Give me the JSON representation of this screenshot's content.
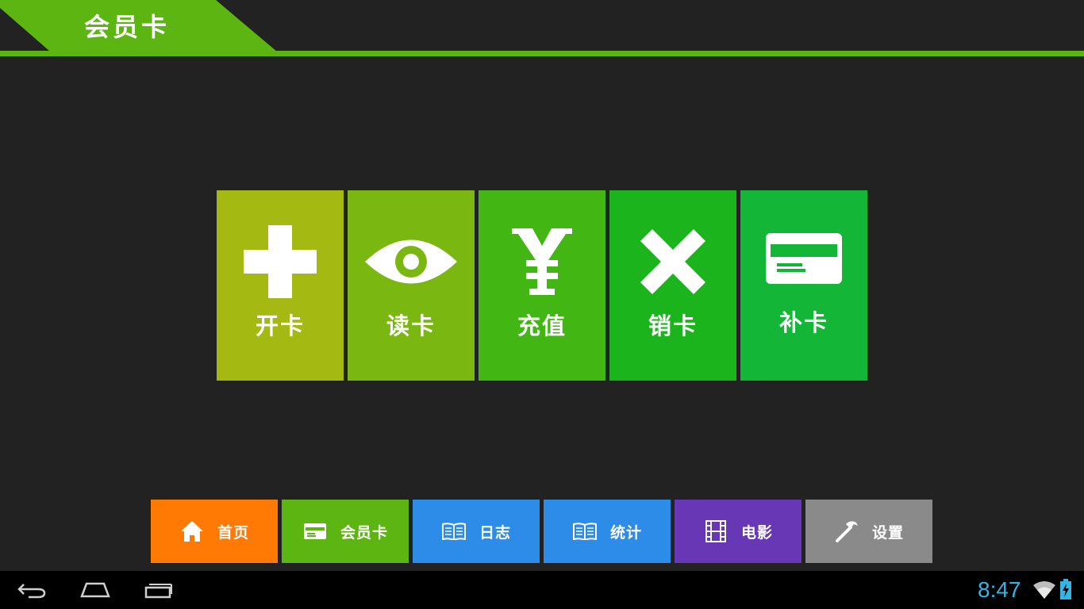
{
  "header": {
    "title": "会员卡",
    "accent_color": "#5cb510"
  },
  "tiles": [
    {
      "label": "开卡",
      "icon": "plus-icon",
      "color": "#a5b913"
    },
    {
      "label": "读卡",
      "icon": "eye-icon",
      "color": "#7ab811"
    },
    {
      "label": "充值",
      "icon": "yen-icon",
      "color": "#42b612"
    },
    {
      "label": "销卡",
      "icon": "x-icon",
      "color": "#1bb41d"
    },
    {
      "label": "补卡",
      "icon": "card-icon",
      "color": "#13b636"
    }
  ],
  "nav": [
    {
      "label": "首页",
      "icon": "home-icon",
      "color": "#ff7a05"
    },
    {
      "label": "会员卡",
      "icon": "card-icon",
      "color": "#5cb510"
    },
    {
      "label": "日志",
      "icon": "book-icon",
      "color": "#2d8ce8"
    },
    {
      "label": "统计",
      "icon": "book-icon",
      "color": "#2d8ce8"
    },
    {
      "label": "电影",
      "icon": "film-icon",
      "color": "#6837b5"
    },
    {
      "label": "设置",
      "icon": "hammer-icon",
      "color": "#8a8a8a"
    }
  ],
  "system_bar": {
    "time": "8:47",
    "clock_color": "#33b5e5",
    "buttons": [
      "back-icon",
      "home-outline-icon",
      "recent-apps-icon"
    ]
  }
}
